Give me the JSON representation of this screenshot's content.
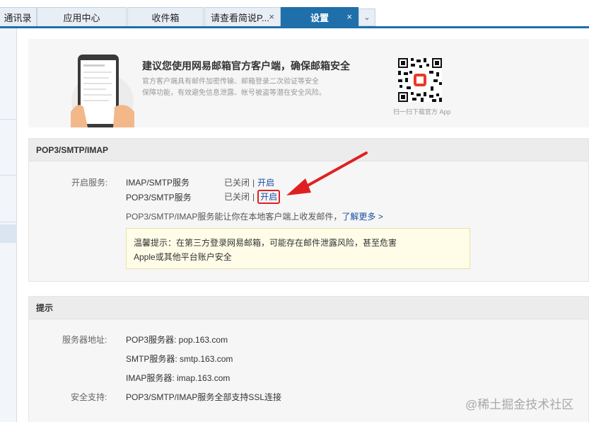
{
  "tabs": [
    {
      "label": "通讯录",
      "active": false
    },
    {
      "label": "应用中心",
      "active": false
    },
    {
      "label": "收件箱",
      "active": false
    },
    {
      "label": "请查看简说P...",
      "active": false,
      "close": "×"
    },
    {
      "label": "设置",
      "active": true,
      "close": "×"
    }
  ],
  "tab_more_icon": "⌄",
  "promo": {
    "title": "建议您使用网易邮箱官方客户端，确保邮箱安全",
    "desc_line1": "官方客户端具有邮件加密传输、邮箱登录二次验证等安全",
    "desc_line2": "保障功能，有效避免信息泄露、帐号被盗等潜在安全风险。",
    "qr_caption": "扫一扫下载官方 App"
  },
  "pop3": {
    "heading": "POP3/SMTP/IMAP",
    "service_label": "开启服务:",
    "services": [
      {
        "name": "IMAP/SMTP服务",
        "status": "已关闭",
        "separator": "|",
        "action": "开启"
      },
      {
        "name": "POP3/SMTP服务",
        "status": "已关闭",
        "separator": "|",
        "action": "开启"
      }
    ],
    "info_text": "POP3/SMTP/IMAP服务能让你在本地客户端上收发邮件，",
    "learn_more": "了解更多 >",
    "notice_line1": "温馨提示：在第三方登录网易邮箱，可能存在邮件泄露风险，甚至危害",
    "notice_line2": "Apple或其他平台账户安全"
  },
  "tips": {
    "heading": "提示",
    "server_label": "服务器地址:",
    "pop3_server": "POP3服务器: pop.163.com",
    "smtp_server": "SMTP服务器: smtp.163.com",
    "imap_server": "IMAP服务器: imap.163.com",
    "security_label": "安全支持:",
    "security_value": "POP3/SMTP/IMAP服务全部支持SSL连接"
  },
  "watermark": "@稀土掘金技术社区",
  "colors": {
    "accent": "#1f6faa",
    "link": "#1a4fa3",
    "annotation": "#e02020"
  }
}
